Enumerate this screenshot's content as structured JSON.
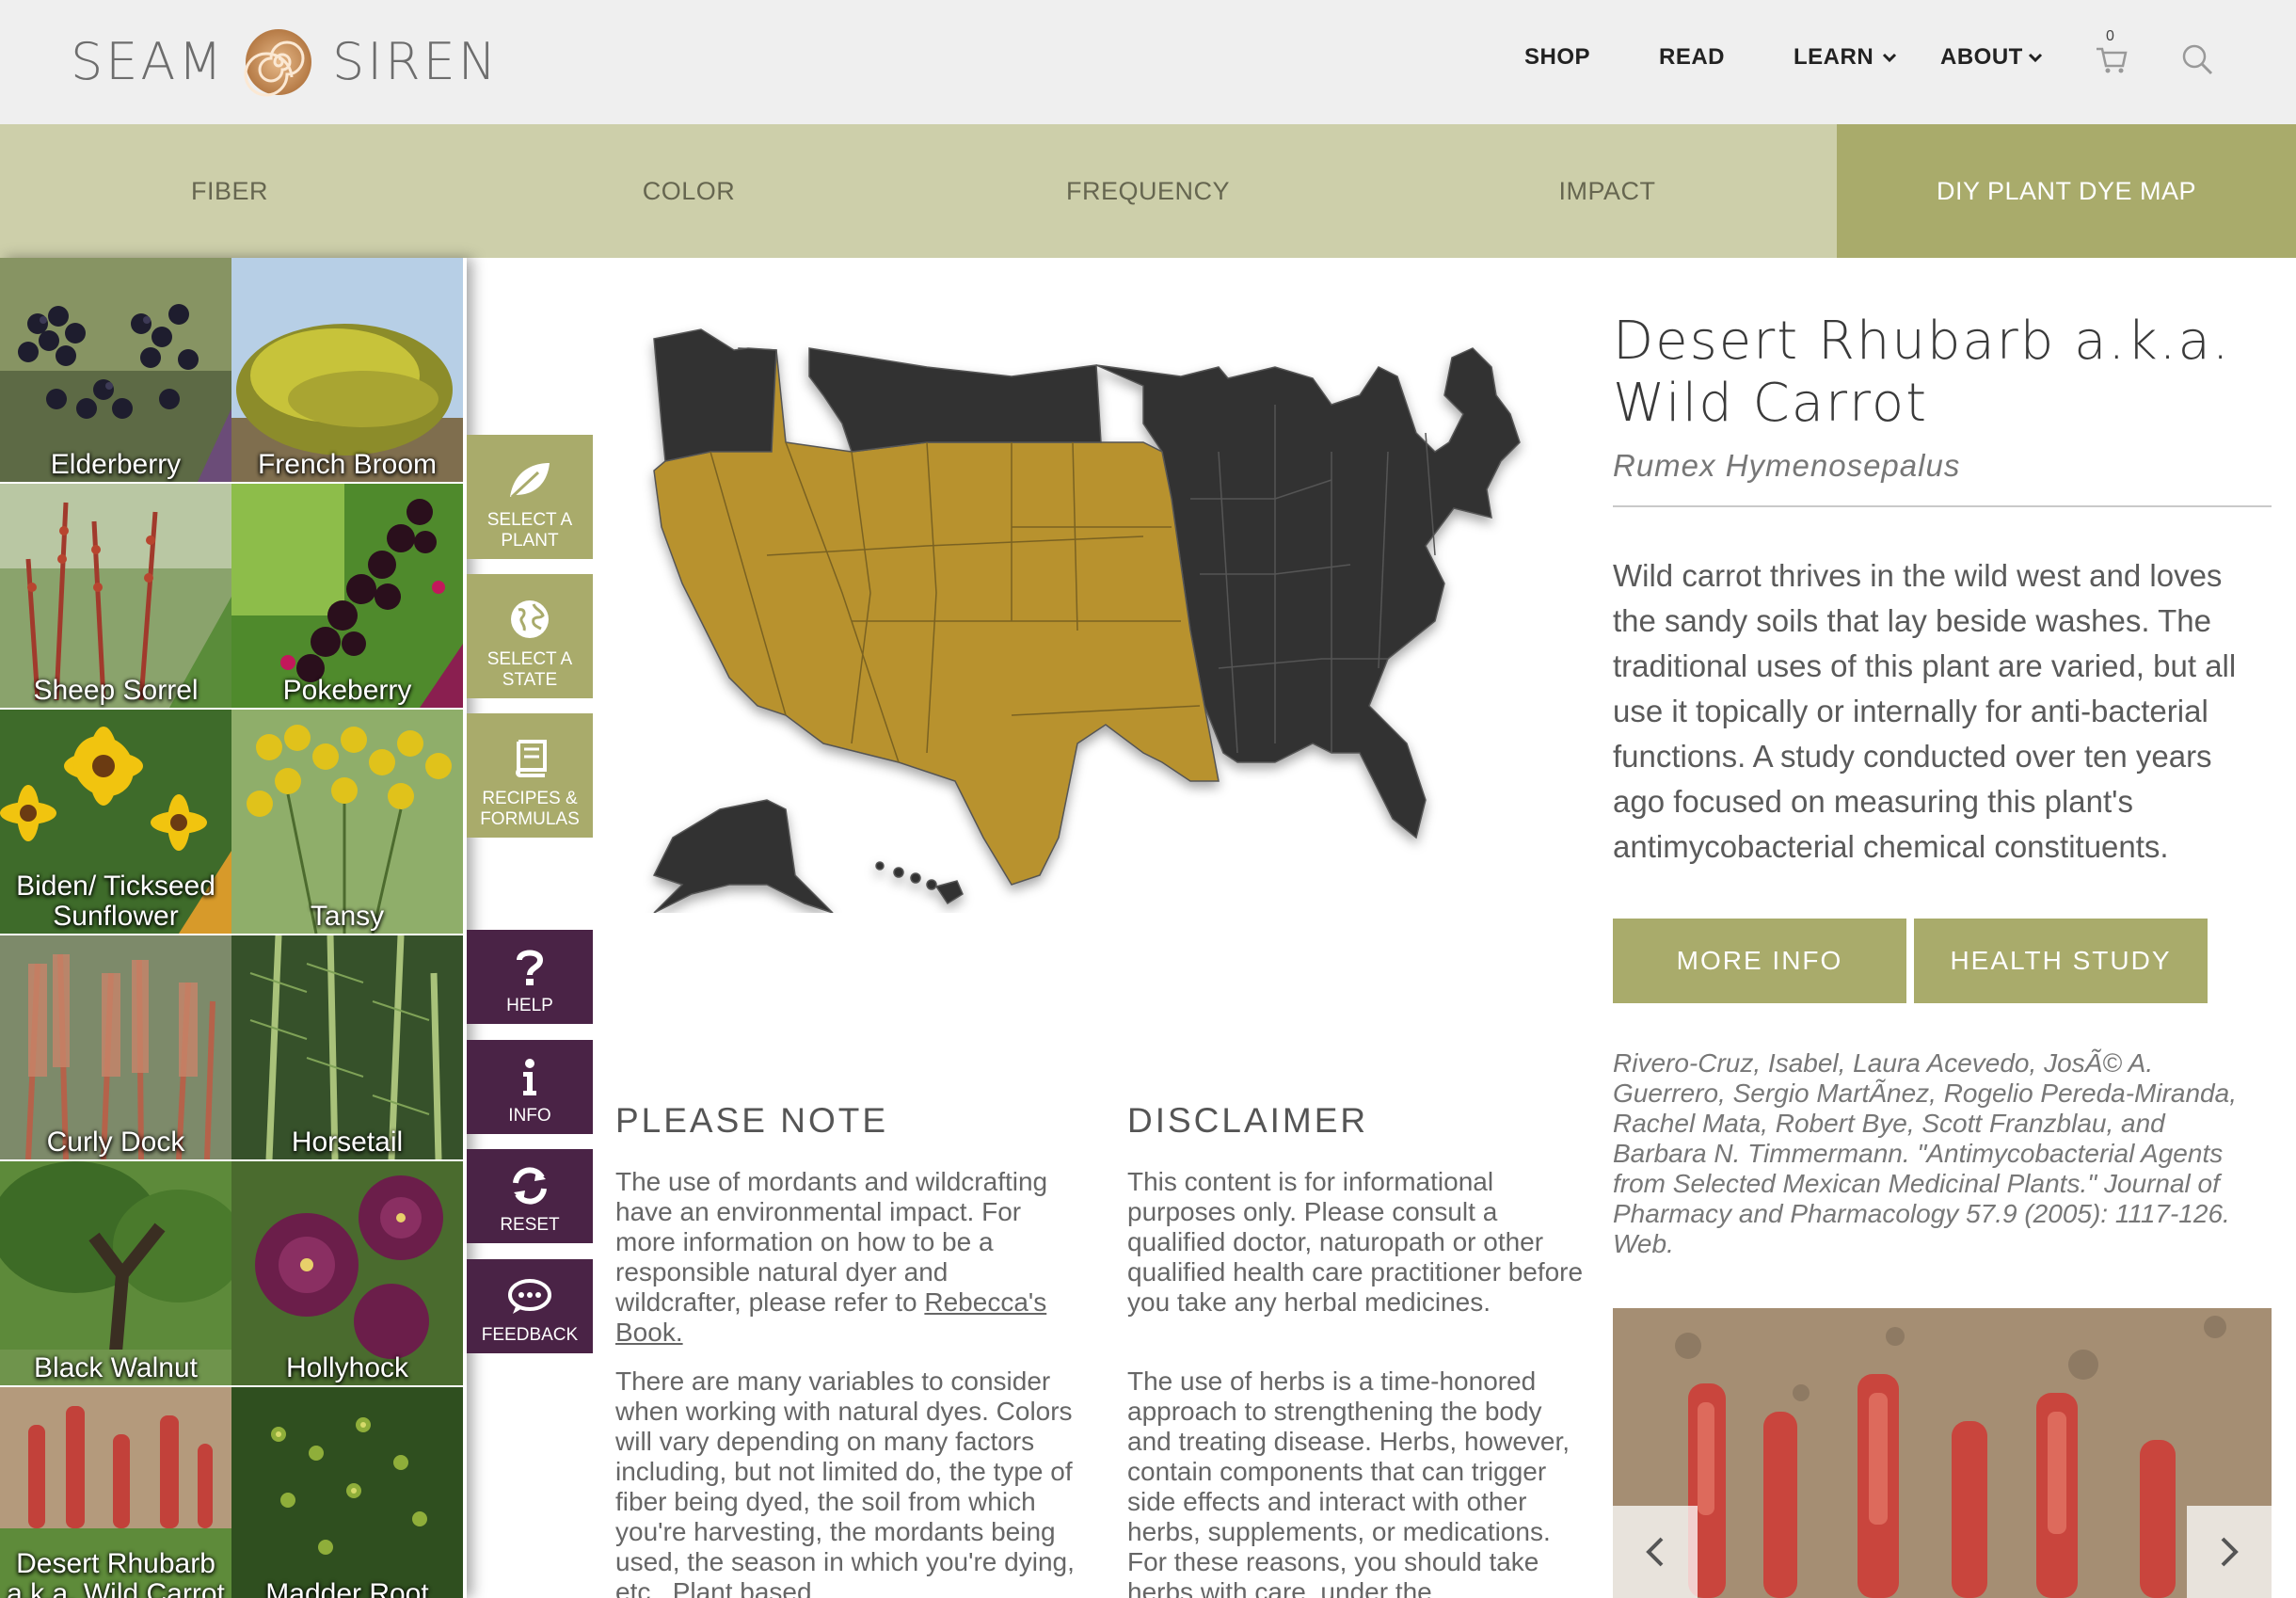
{
  "brand": {
    "word_left": "SEAM",
    "word_right": "SIREN",
    "logo_icon": "spiral-logo-icon"
  },
  "nav": {
    "shop": "SHOP",
    "read": "READ",
    "learn": "LEARN",
    "about": "ABOUT",
    "cart_count": "0",
    "cart_icon": "cart-icon",
    "search_icon": "search-icon"
  },
  "tabs": [
    {
      "label": "FIBER",
      "active": false
    },
    {
      "label": "COLOR",
      "active": false
    },
    {
      "label": "FREQUENCY",
      "active": false
    },
    {
      "label": "IMPACT",
      "active": false
    },
    {
      "label": "DIY PLANT DYE MAP",
      "active": true
    }
  ],
  "plants": [
    {
      "label": "Elderberry"
    },
    {
      "label": "French Broom"
    },
    {
      "label": "Sheep Sorrel"
    },
    {
      "label": "Pokeberry"
    },
    {
      "label": "Biden/ Tickseed Sunflower"
    },
    {
      "label": "Tansy"
    },
    {
      "label": "Curly Dock"
    },
    {
      "label": "Horsetail"
    },
    {
      "label": "Black Walnut"
    },
    {
      "label": "Hollyhock"
    },
    {
      "label": "Desert Rhubarb a.k.a. Wild Carrot"
    },
    {
      "label": "Madder Root"
    }
  ],
  "actions": {
    "select_plant": "SELECT A PLANT",
    "select_state": "SELECT A STATE",
    "recipes": "RECIPES & FORMULAS",
    "help": "HELP",
    "info": "INFO",
    "reset": "RESET",
    "feedback": "FEEDBACK"
  },
  "detail": {
    "title": "Desert Rhubarb a.k.a. Wild Carrot",
    "latin": "Rumex Hymenosepalus",
    "description": "Wild carrot thrives in the wild west and loves the sandy soils that lay beside washes. The traditional uses of this plant are varied, but all use it topically or internally for anti-bacterial functions. A study conducted over ten years ago focused on measuring this plant's antimycobacterial chemical constituents.",
    "more_info": "MORE INFO",
    "health_study": "HEALTH STUDY",
    "citation": "Rivero-Cruz, Isabel, Laura Acevedo, JosÃ© A. Guerrero, Sergio MartÃ­nez, Rogelio Pereda-Miranda, Rachel Mata, Robert Bye, Scott Franzblau, and Barbara N. Timmermann. \"Antimycobacterial Agents from Selected Mexican Medicinal Plants.\" Journal of Pharmacy and Pharmacology 57.9 (2005): 1117-126. Web."
  },
  "notes": {
    "please_note_heading": "PLEASE NOTE",
    "please_note_p1": "The use of mordants and wildcrafting have an environmental impact. For more information on how to be a responsible natural dyer and wildcrafter, please refer to",
    "please_note_link": "Rebecca's Book.",
    "please_note_p2": "There are many variables to consider when working with natural dyes. Colors will vary depending on many factors including, but not limited do, the type of fiber being dyed, the soil from which you're harvesting, the mordants being used, the season in which you're dying, etc.. Plant based",
    "disclaimer_heading": "DISCLAIMER",
    "disclaimer_p1": "This content is for informational purposes only. Please consult a qualified doctor, naturopath or other qualified health care practitioner before you take any herbal medicines.",
    "disclaimer_p2": "The use of herbs is a time-honored approach to strengthening the body and treating disease. Herbs, however, contain components that can trigger side effects and interact with other herbs, supplements, or medications. For these reasons, you should take herbs with care, under the"
  },
  "colors": {
    "header_bg": "#efefef",
    "tab_bg": "#cdcfaa",
    "accent_olive": "#a9ab6b",
    "action_purple": "#4a2346",
    "map_highlight": "#b8922e",
    "map_dark": "#333333"
  }
}
